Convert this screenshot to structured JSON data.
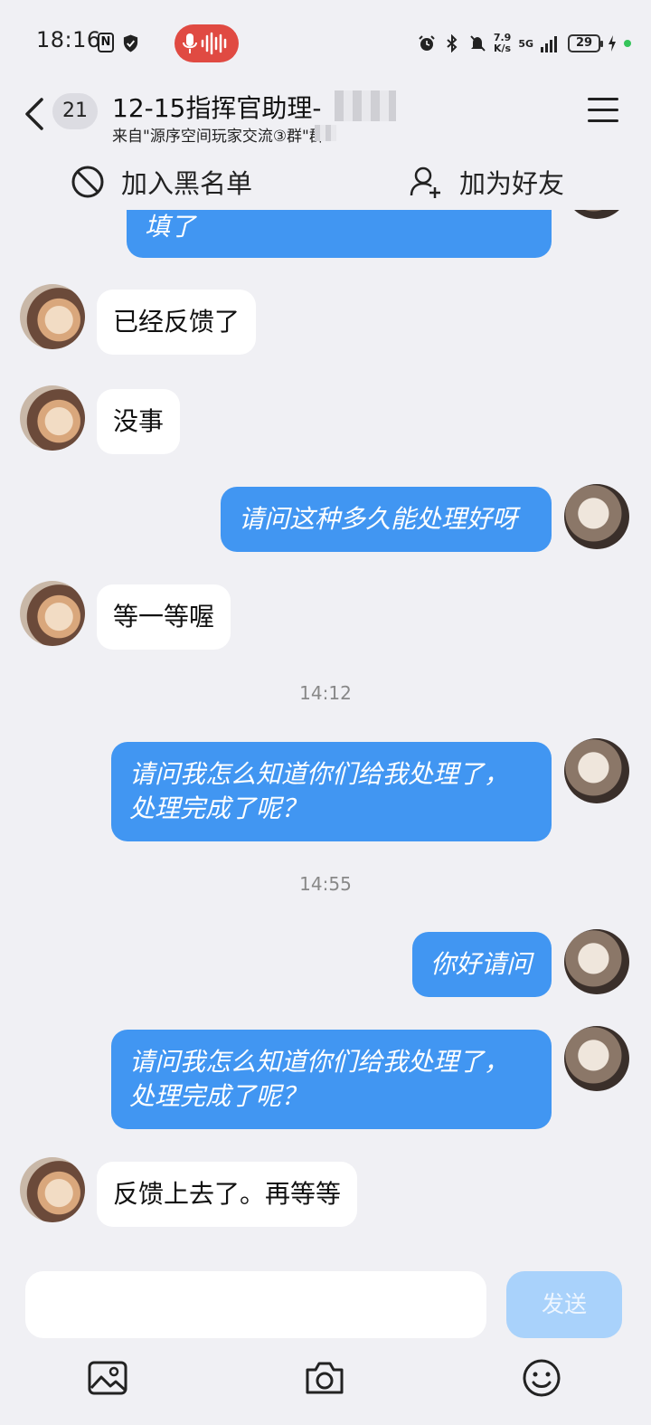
{
  "status_bar": {
    "time": "18:16",
    "nfc_label": "N",
    "net_speed_top": "7.9",
    "net_speed_bottom": "K/s",
    "network_type": "5G",
    "battery": "29"
  },
  "header": {
    "unread_count": "21",
    "title": "12-15指挥官助理-",
    "subtitle": "来自\"源序空间玩家交流③群\"群"
  },
  "actions": {
    "blacklist_label": "加入黑名单",
    "add_friend_label": "加为好友"
  },
  "messages": [
    {
      "side": "out",
      "text": "填了"
    },
    {
      "side": "in",
      "text": "已经反馈了"
    },
    {
      "side": "in",
      "text": "没事"
    },
    {
      "side": "out",
      "text": "请问这种多久能处理好呀"
    },
    {
      "side": "in",
      "text": "等一等喔"
    },
    {
      "side": "out",
      "text": "请问我怎么知道你们给我处理了，处理完成了呢？"
    },
    {
      "side": "out",
      "text": "你好请问"
    },
    {
      "side": "out",
      "text": "请问我怎么知道你们给我处理了，处理完成了呢？"
    },
    {
      "side": "in",
      "text": "反馈上去了。再等等"
    }
  ],
  "timestamps": [
    "14:12",
    "14:55"
  ],
  "composer": {
    "send_label": "发送"
  },
  "colors": {
    "outgoing_bubble": "#4196f2",
    "incoming_bubble": "#ffffff",
    "send_button_disabled": "#a9d2fb",
    "recording_pill": "#e04a42"
  },
  "icons": [
    "back-icon",
    "menu-icon",
    "block-icon",
    "add-friend-icon",
    "image-icon",
    "camera-icon",
    "emoji-icon",
    "microphone-icon"
  ]
}
